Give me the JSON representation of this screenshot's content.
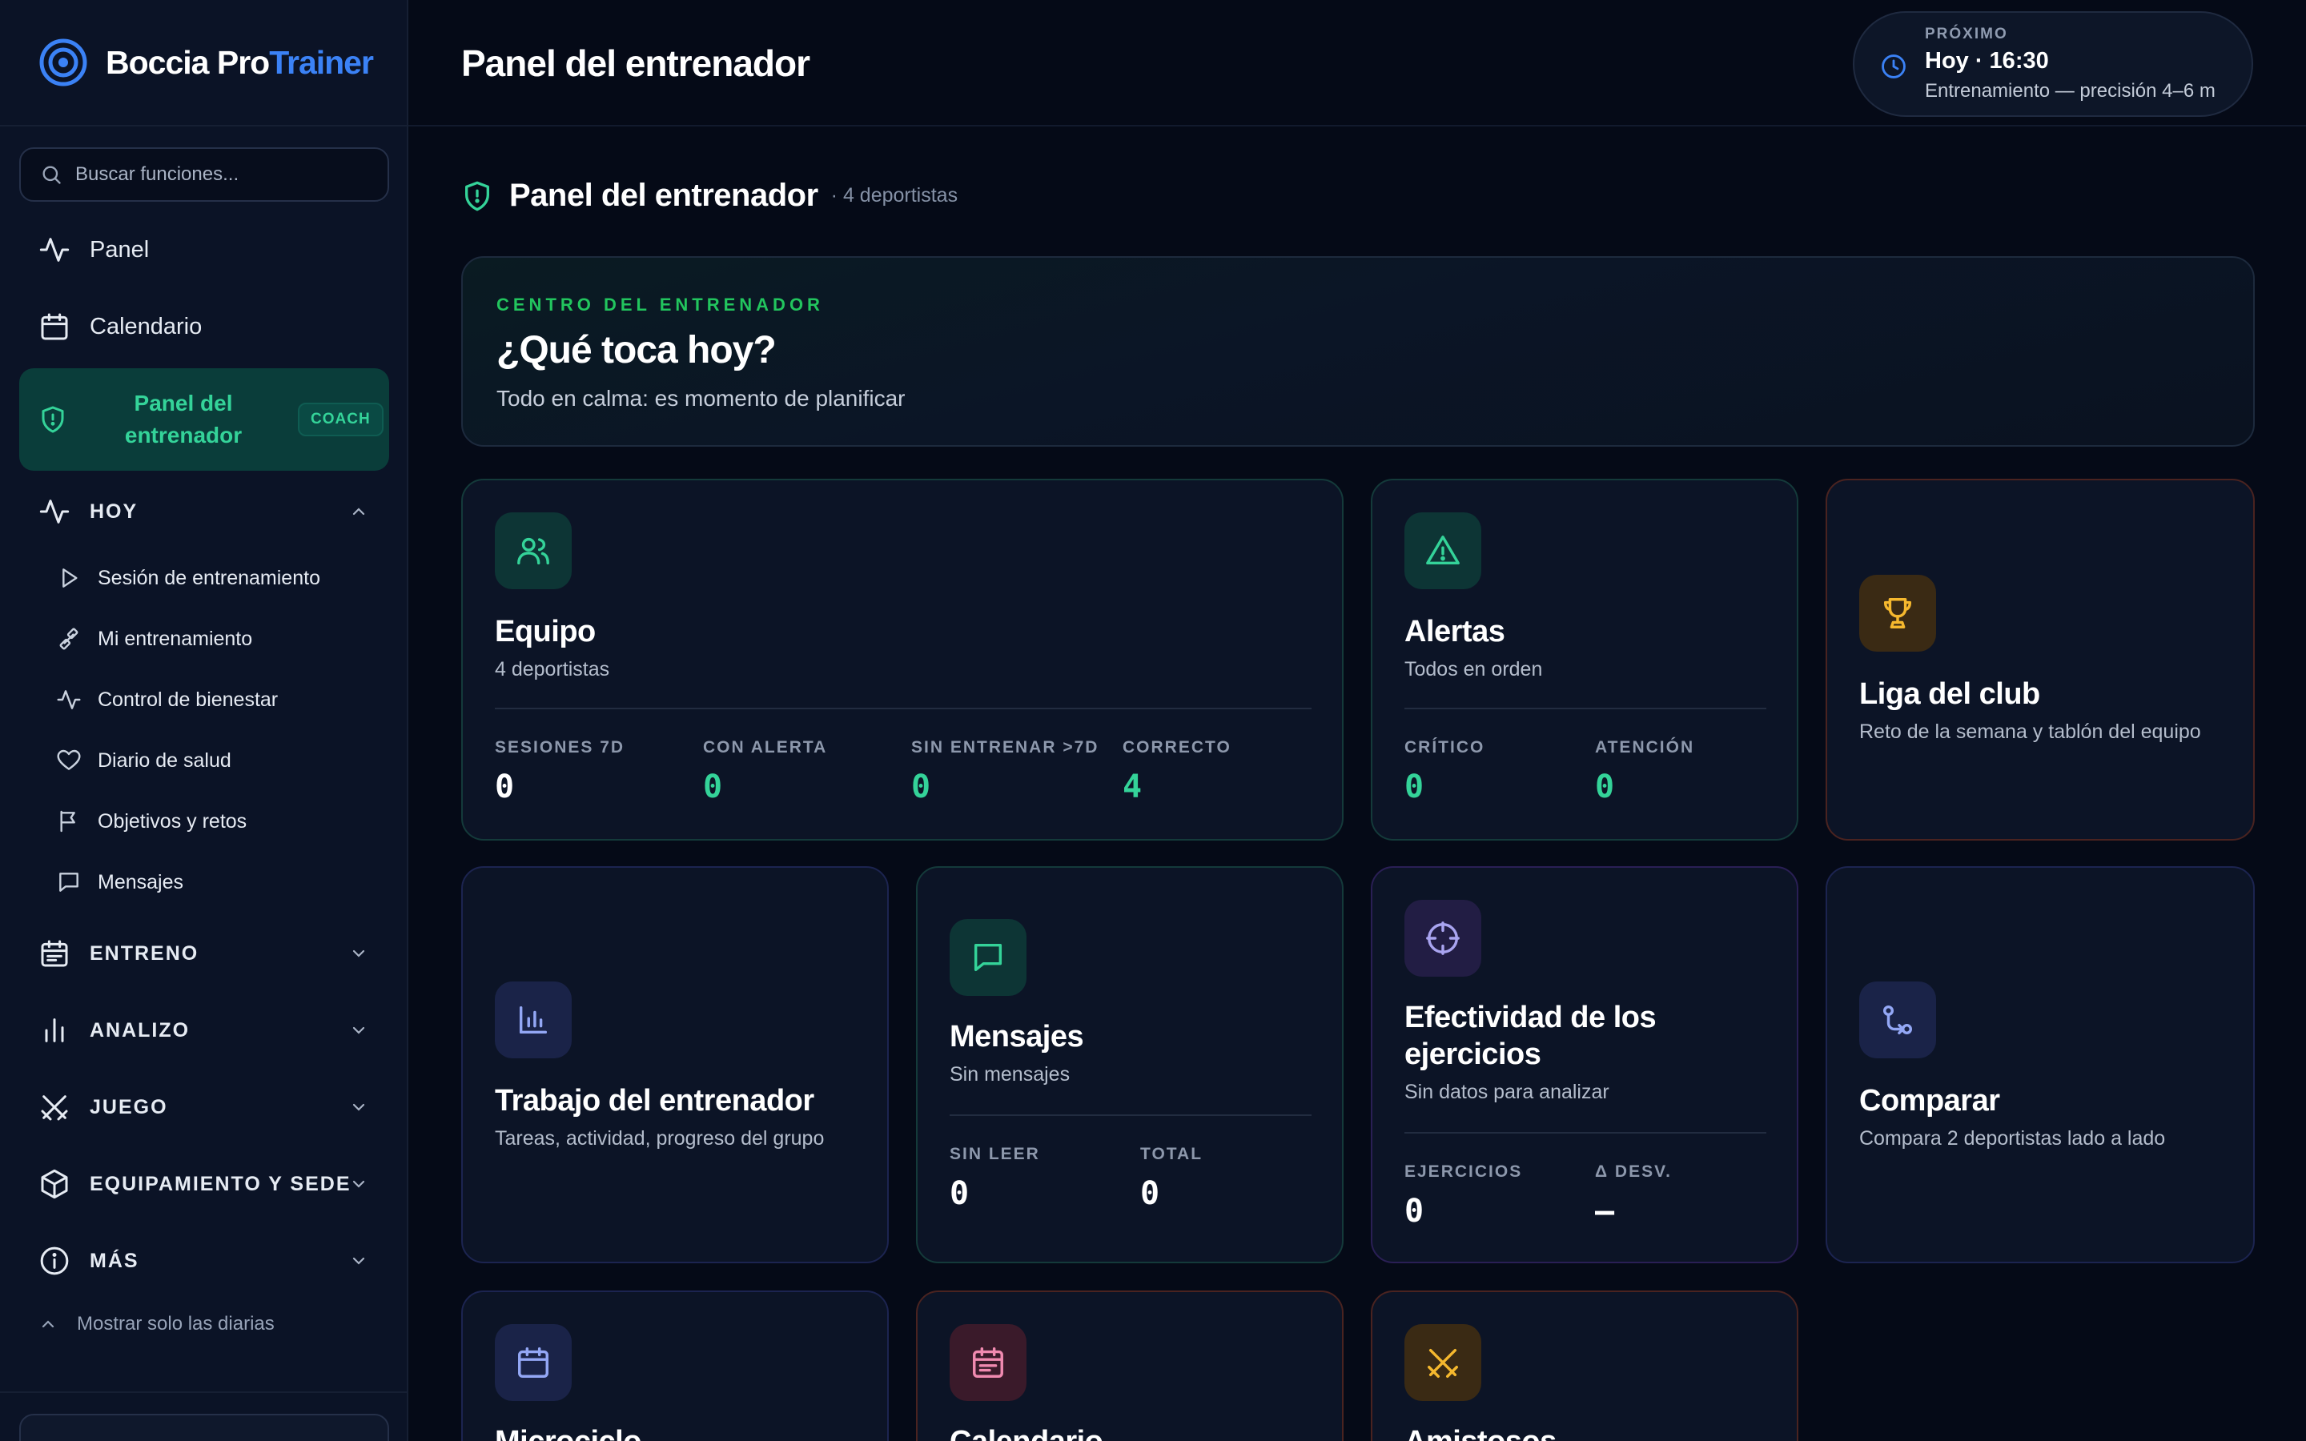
{
  "brand": {
    "name_part1": "Boccia Pro",
    "name_part2": "Trainer"
  },
  "search": {
    "placeholder": "Buscar funciones..."
  },
  "nav": {
    "panel": "Panel",
    "calendar": "Calendario",
    "coach_panel": "Panel del entrenador",
    "coach_badge": "COACH"
  },
  "sections": {
    "today": {
      "label": "HOY",
      "items": [
        {
          "label": "Sesión de entrenamiento",
          "icon": "play-icon"
        },
        {
          "label": "Mi entrenamiento",
          "icon": "dumbbell-icon"
        },
        {
          "label": "Control de bienestar",
          "icon": "activity-icon"
        },
        {
          "label": "Diario de salud",
          "icon": "heart-icon"
        },
        {
          "label": "Objetivos y retos",
          "icon": "flag-icon"
        },
        {
          "label": "Mensajes",
          "icon": "message-icon"
        }
      ]
    },
    "training": "ENTRENO",
    "analysis": "ANALIZO",
    "game": "JUEGO",
    "equipment": "EQUIPAMIENTO Y SEDE",
    "more": "MÁS"
  },
  "show_daily": "Mostrar solo las diarias",
  "header": {
    "title": "Panel del entrenador",
    "next": {
      "label": "PRÓXIMO",
      "time": "Hoy · 16:30",
      "desc": "Entrenamiento — precisión 4–6 m"
    }
  },
  "main": {
    "section_title": "Panel del entrenador",
    "section_sub": "· 4 deportistas",
    "hero": {
      "eyebrow": "CENTRO DEL ENTRENADOR",
      "question": "¿Qué toca hoy?",
      "subtitle": "Todo en calma: es momento de planificar"
    },
    "cards": {
      "team": {
        "title": "Equipo",
        "subtitle": "4 deportistas",
        "stats": [
          {
            "label": "SESIONES 7D",
            "value": "0"
          },
          {
            "label": "CON ALERTA",
            "value": "0"
          },
          {
            "label": "SIN ENTRENAR >7D",
            "value": "0"
          },
          {
            "label": "CORRECTO",
            "value": "4"
          }
        ]
      },
      "alerts": {
        "title": "Alertas",
        "subtitle": "Todos en orden",
        "stats": [
          {
            "label": "CRÍTICO",
            "value": "0"
          },
          {
            "label": "ATENCIÓN",
            "value": "0"
          }
        ]
      },
      "league": {
        "title": "Liga del club",
        "subtitle": "Reto de la semana y tablón del equipo"
      },
      "coach_work": {
        "title": "Trabajo del entrenador",
        "subtitle": "Tareas, actividad, progreso del grupo"
      },
      "messages": {
        "title": "Mensajes",
        "subtitle": "Sin mensajes",
        "stats": [
          {
            "label": "SIN LEER",
            "value": "0"
          },
          {
            "label": "TOTAL",
            "value": "0"
          }
        ]
      },
      "effectiveness": {
        "title_line1": "Efectividad de los",
        "title_line2": "ejercicios",
        "subtitle": "Sin datos para analizar",
        "stats": [
          {
            "label": "EJERCICIOS",
            "value": "0"
          },
          {
            "label": "Δ DESV.",
            "value": "–"
          }
        ]
      },
      "compare": {
        "title": "Comparar",
        "subtitle": "Compara 2 deportistas lado a lado"
      },
      "microcycle": {
        "title": "Microciclo"
      },
      "calendar": {
        "title": "Calendario"
      },
      "friendlies": {
        "title": "Amistosos"
      }
    }
  },
  "colors": {
    "background": "#050a17",
    "sidebar": "#0b1326",
    "accent_blue": "#3b82f6",
    "accent_green": "#34d399",
    "active_bg": "#0a3d3a"
  }
}
